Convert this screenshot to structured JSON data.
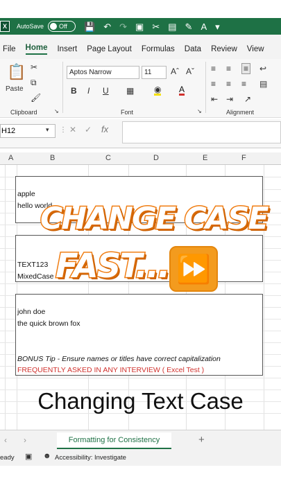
{
  "qat": {
    "autosave_label": "AutoSave",
    "toggle_label": "Off",
    "app_icon": "X"
  },
  "menu": {
    "tabs": [
      {
        "label": "File"
      },
      {
        "label": "Home"
      },
      {
        "label": "Insert"
      },
      {
        "label": "Page Layout"
      },
      {
        "label": "Formulas"
      },
      {
        "label": "Data"
      },
      {
        "label": "Review"
      },
      {
        "label": "View"
      }
    ],
    "active": "Home"
  },
  "ribbon": {
    "paste_label": "Paste",
    "clipboard_label": "Clipboard",
    "font_label": "Font",
    "alignment_label": "Alignment",
    "font_name": "Aptos Narrow",
    "font_size": "11",
    "bold": "B",
    "italic": "I",
    "underline": "U"
  },
  "formula_bar": {
    "name_box": "H12",
    "fx": "fx"
  },
  "columns": [
    "A",
    "B",
    "C",
    "D",
    "E",
    "F"
  ],
  "cells": {
    "apple": "apple",
    "hello": "hello world",
    "text123": "TEXT123",
    "mixedcase": "MixedCase",
    "john": "john doe",
    "quick": "the quick brown fox",
    "bonus": "BONUS Tip - Ensure names or titles have correct capitalization",
    "frequent": "FREQUENTLY ASKED IN ANY INTERVIEW ( Excel Test )"
  },
  "big_title": "Changing Text Case",
  "overlay": {
    "line1": "CHANGE CASE",
    "line2": "FAST...!",
    "ff_icon": "fast-forward-icon"
  },
  "sheet_tab": "Formatting for Consistency",
  "status": {
    "ready": "eady",
    "accessibility": "Accessibility: Investigate"
  },
  "colors": {
    "excel_green": "#1e7145",
    "overlay_orange": "#f07d12",
    "red_text": "#d0312d"
  }
}
